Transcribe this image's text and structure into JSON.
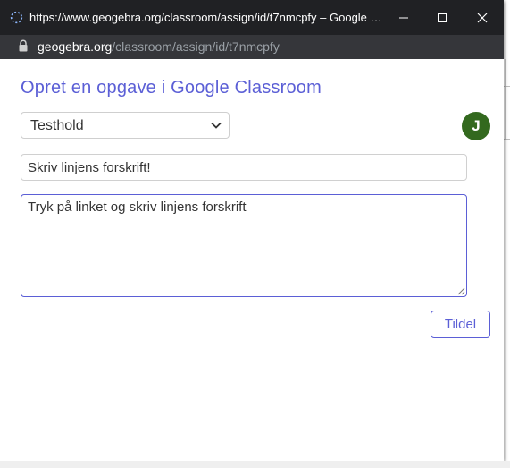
{
  "window": {
    "title": "https://www.geogebra.org/classroom/assign/id/t7nmcpfy – Google Chro...",
    "minimize_icon": "minimize-icon",
    "maximize_icon": "maximize-icon",
    "close_icon": "close-icon"
  },
  "urlbar": {
    "host": "geogebra.org",
    "path": "/classroom/assign/id/t7nmcpfy",
    "lock_icon": "lock-icon"
  },
  "page": {
    "heading": "Opret en opgave i Google Classroom",
    "class_select": {
      "selected": "Testhold",
      "options": [
        "Testhold"
      ]
    },
    "avatar_initial": "J",
    "assignment_title_value": "Skriv linjens forskrift!",
    "assignment_description_value": "Tryk på linket og skriv linjens forskrift",
    "assign_button_label": "Tildel"
  },
  "colors": {
    "accent": "#5b5fd6",
    "titlebar": "#202124",
    "urlbar": "#35363a",
    "avatar": "#33691e"
  }
}
